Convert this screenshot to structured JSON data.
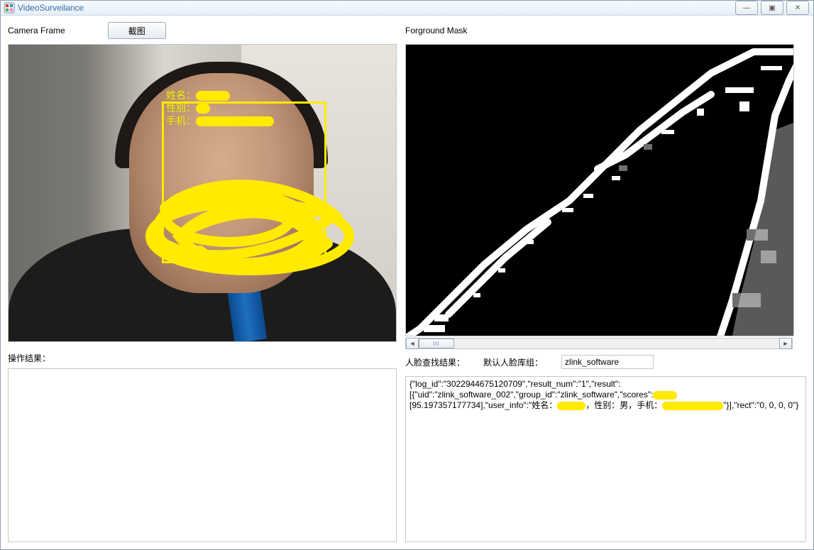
{
  "window": {
    "title": "VideoSurveilance",
    "min_glyph": "—",
    "max_glyph": "▣",
    "close_glyph": "✕"
  },
  "left": {
    "camera_label": "Camera Frame",
    "screenshot_btn": "截图",
    "overlay_name_label": "姓名：",
    "overlay_gender_label": "性别：",
    "overlay_phone_label": "手机：",
    "overlay_name_value": "█████",
    "overlay_gender_value": "█",
    "overlay_phone_value": "███████████",
    "op_result_label": "操作结果："
  },
  "right": {
    "mask_label": "Forground Mask",
    "search_result_label": "人脸查找结果：",
    "default_group_label": "默认人脸库组：",
    "group_value": "zlink_software",
    "result_line1": "{\"log_id\":\"3022944675120709\",\"result_num\":\"1\",\"result\":",
    "result_line2a": "[{\"uid\":\"zlink_software_002\",\"group_id\":\"zlink_software\",\"scores\":",
    "result_line3a": "[95.197357177734],\"user_info\":\"姓名：",
    "result_line3b": "，性别：男，手机：",
    "result_line3c": "\"}],\"rect\":\"0, 0, 0, 0\"}"
  }
}
